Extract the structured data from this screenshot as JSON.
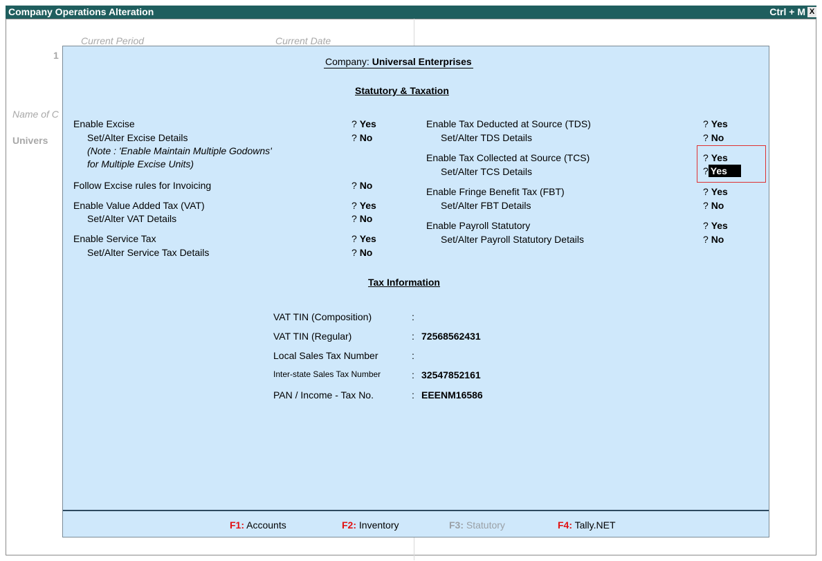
{
  "titlebar": {
    "title": "Company Operations  Alteration",
    "shortcut": "Ctrl + M",
    "close_glyph": "X"
  },
  "background": {
    "current_period": "Current Period",
    "current_date": "Current Date",
    "period_partial": "1",
    "name_partial": "Name of C",
    "company_partial": "Univers"
  },
  "company": {
    "label": "Company:",
    "name": "Universal Enterprises"
  },
  "section_statutory": "Statutory & Taxation",
  "left": {
    "excise_label": "Enable Excise",
    "excise_value": "Yes",
    "excise_details_label": "Set/Alter Excise Details",
    "excise_details_value": "No",
    "note_line1": "(Note : 'Enable Maintain Multiple Godowns'",
    "note_line2": "for Multiple Excise Units)",
    "invoicing_label": "Follow Excise rules for Invoicing",
    "invoicing_value": "No",
    "vat_label": "Enable Value Added Tax (VAT)",
    "vat_value": "Yes",
    "vat_details_label": "Set/Alter VAT Details",
    "vat_details_value": "No",
    "service_label": "Enable Service Tax",
    "service_value": "Yes",
    "service_details_label": "Set/Alter Service Tax Details",
    "service_details_value": "No"
  },
  "right": {
    "tds_label": "Enable Tax Deducted at Source (TDS)",
    "tds_value": "Yes",
    "tds_details_label": "Set/Alter TDS Details",
    "tds_details_value": "No",
    "tcs_label": "Enable Tax Collected at Source (TCS)",
    "tcs_value": "Yes",
    "tcs_details_label": "Set/Alter TCS Details",
    "tcs_details_value": "Yes",
    "fbt_label": "Enable Fringe Benefit Tax (FBT)",
    "fbt_value": "Yes",
    "fbt_details_label": "Set/Alter FBT Details",
    "fbt_details_value": "No",
    "payroll_label": "Enable Payroll Statutory",
    "payroll_value": "Yes",
    "payroll_details_label": "Set/Alter Payroll Statutory Details",
    "payroll_details_value": "No"
  },
  "prompt_mark": "?",
  "section_tax": "Tax Information",
  "tax": {
    "vat_comp_label": "VAT TIN (Composition)",
    "vat_comp_value": "",
    "vat_reg_label": "VAT TIN (Regular)",
    "vat_reg_value": "72568562431",
    "lst_label": "Local Sales Tax Number",
    "lst_value": "",
    "cst_label": "Inter-state Sales Tax Number",
    "cst_value": "32547852161",
    "pan_label": "PAN / Income - Tax No.",
    "pan_value": "EEENM16586",
    "colon": ":"
  },
  "footer": {
    "f1_key": "F1:",
    "f1_label": "Accounts",
    "f2_key": "F2:",
    "f2_label": "Inventory",
    "f3_key": "F3:",
    "f3_label": "Statutory",
    "f4_key": "F4:",
    "f4_label": "Tally.NET"
  },
  "colors": {
    "title_bg": "#1f5e5e",
    "panel_bg": "#cfe8fb",
    "fkey": "#e21010",
    "highlight": "#e03030"
  }
}
